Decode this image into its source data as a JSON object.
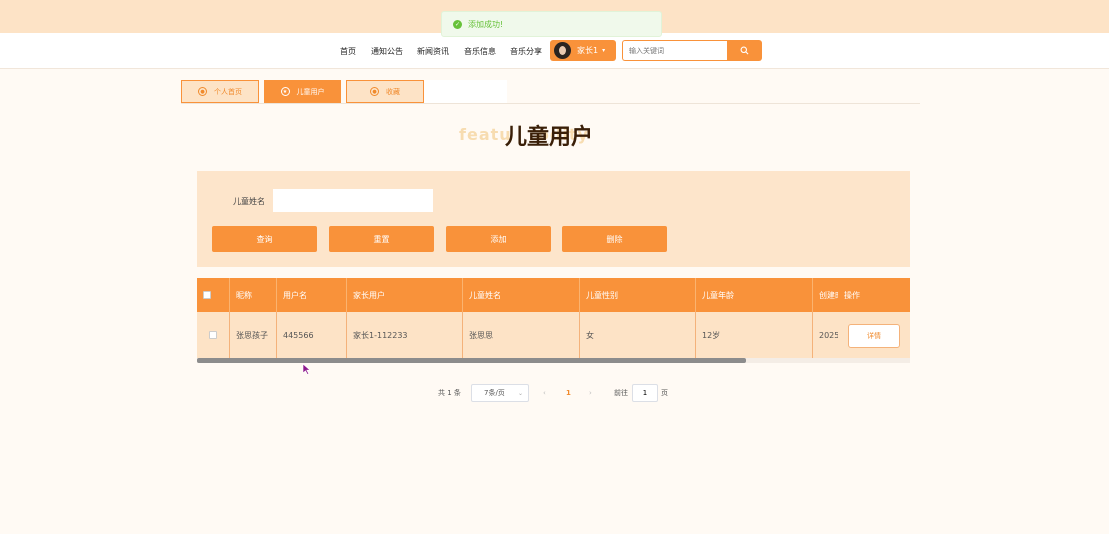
{
  "toast": {
    "message": "添加成功!",
    "icon": "check-circle-icon"
  },
  "nav": {
    "items": [
      "首页",
      "通知公告",
      "新闻资讯",
      "音乐信息",
      "音乐分享"
    ],
    "user": {
      "name": "家长1",
      "caret": "▾"
    },
    "search": {
      "placeholder": "输入关键词",
      "icon": "search-icon"
    }
  },
  "tabs": [
    {
      "label": "个人首页",
      "active": false
    },
    {
      "label": "儿童用户",
      "active": true
    },
    {
      "label": "收藏",
      "active": false
    }
  ],
  "title": {
    "main": "儿童用户",
    "background": "featu    odity"
  },
  "filter": {
    "label": "儿童姓名",
    "value": "",
    "buttons": [
      "查询",
      "重置",
      "添加",
      "删除"
    ]
  },
  "table": {
    "headers": [
      "昵称",
      "用户名",
      "家长用户",
      "儿童姓名",
      "儿童性别",
      "儿童年龄",
      "创建时",
      "操作"
    ],
    "rows": [
      {
        "nickname": "张思孩子",
        "username": "445566",
        "parent": "家长1-112233",
        "child_name": "张思思",
        "gender": "女",
        "age": "12岁",
        "created": "2025-",
        "action": "详情"
      }
    ],
    "scroll_position": 0.77
  },
  "pagination": {
    "total": "共 1 条",
    "page_size": "7条/页",
    "prev": "‹",
    "current": "1",
    "next": "›",
    "goto_label": "前往",
    "goto_value": "1",
    "page_suffix": "页"
  },
  "colors": {
    "accent": "#f9923a",
    "band": "#fde3c6",
    "success": "#67c23a"
  }
}
